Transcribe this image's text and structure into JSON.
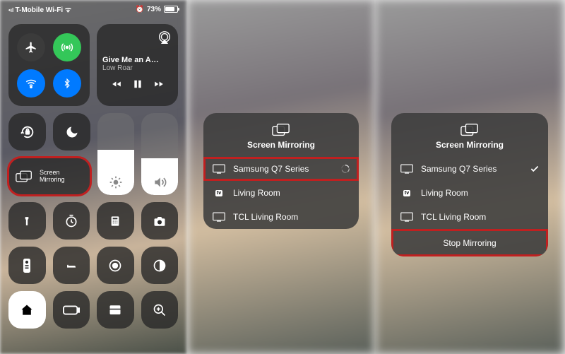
{
  "status": {
    "carrier": "T-Mobile Wi-Fi",
    "battery_pct": "73%"
  },
  "connectivity": {
    "airplane": "airplane-icon",
    "cellular": "cellular-icon",
    "wifi": "wifi-icon",
    "bluetooth": "bluetooth-icon"
  },
  "music": {
    "title": "Give Me an A…",
    "artist": "Low Roar"
  },
  "controls": {
    "screen_mirroring_label": "Screen\nMirroring"
  },
  "mirror": {
    "header": "Screen Mirroring",
    "devices": [
      {
        "icon": "tv",
        "name": "Samsung Q7 Series"
      },
      {
        "icon": "atv",
        "name": "Living Room"
      },
      {
        "icon": "tv",
        "name": "TCL Living Room"
      }
    ],
    "stop_label": "Stop Mirroring"
  }
}
